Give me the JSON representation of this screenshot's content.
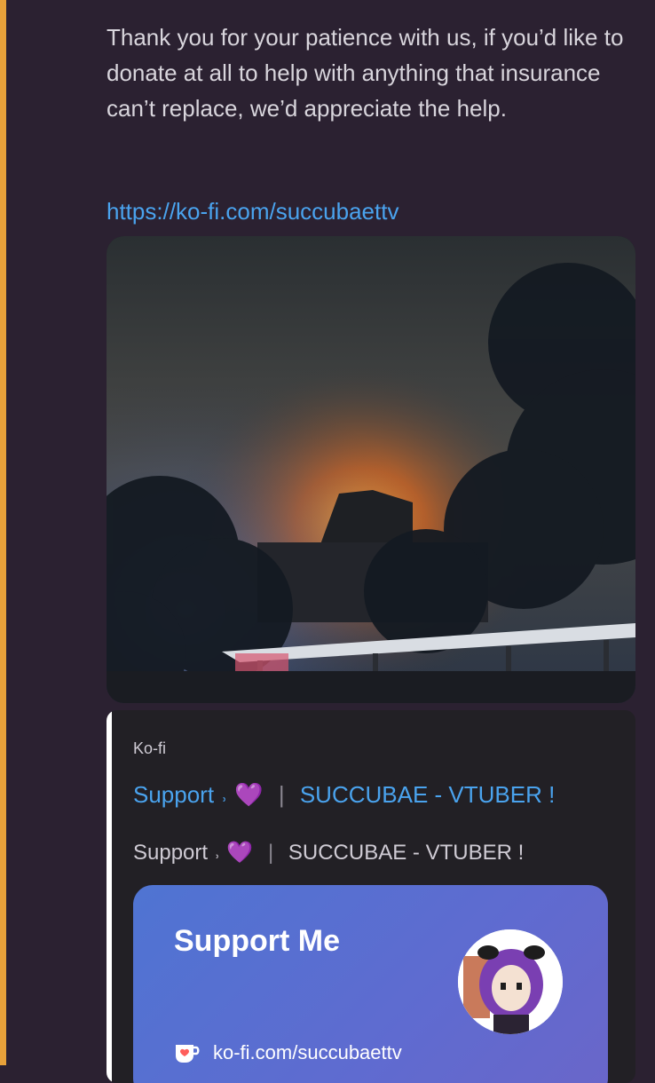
{
  "message": {
    "text": "Thank you for your patience with us, if you’d like to donate at all to help with anything that insurance can’t replace, we’d appreciate the help.",
    "link": "https://ko-fi.com/succubaettv"
  },
  "embed": {
    "provider": "Ko-fi",
    "title_prefix": "Support",
    "title_suffix": "SUCCUBAE - VTUBER !",
    "description_prefix": "Support",
    "description_suffix": "SUCCUBAE - VTUBER !",
    "glyph": "˒",
    "heart": "💜",
    "separator": "|"
  },
  "card": {
    "title": "Support Me",
    "url": "ko-fi.com/succubaettv",
    "icon": "kofi-cup-icon"
  },
  "colors": {
    "background": "#2b2131",
    "link": "#4aa3ee",
    "accent_bar": "#e7a13a",
    "card_gradient_start": "#4f74d2",
    "card_gradient_end": "#6a66c9"
  }
}
